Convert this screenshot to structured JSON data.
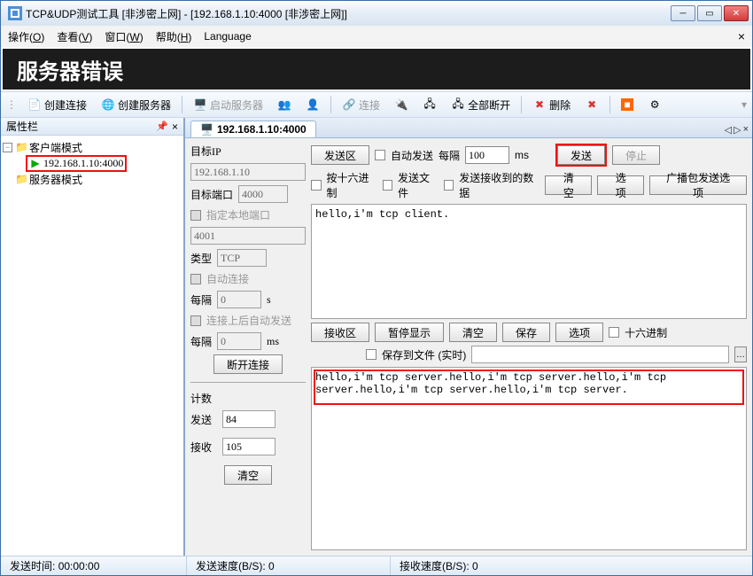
{
  "window": {
    "title": "TCP&UDP测试工具 [非涉密上网] - [192.168.1.10:4000 [非涉密上网]]"
  },
  "menu": {
    "operate": "操作(O)",
    "view": "查看(V)",
    "window": "窗口(W)",
    "help": "帮助(H)",
    "language": "Language"
  },
  "banner": "服务器错误",
  "toolbar": {
    "create_conn": "创建连接",
    "create_server": "创建服务器",
    "start_server": "启动服务器",
    "connect": "连接",
    "disconnect_all": "全部断开",
    "delete": "删除"
  },
  "sidebar": {
    "title": "属性栏",
    "nodes": {
      "client_mode": "客户端模式",
      "conn_addr": "192.168.1.10:4000",
      "server_mode": "服务器模式"
    }
  },
  "tab": {
    "label": "192.168.1.10:4000"
  },
  "form": {
    "target_ip_label": "目标IP",
    "target_ip": "192.168.1.10",
    "target_port_label": "目标端口",
    "target_port": "4000",
    "bind_local_port": "指定本地端口",
    "local_port": "4001",
    "type_label": "类型",
    "type_value": "TCP",
    "auto_connect": "自动连接",
    "interval_label": "每隔",
    "interval_unit_s": "s",
    "interval_unit_ms": "ms",
    "auto_send_after_conn": "连接上后自动发送",
    "disconnect_btn": "断开连接",
    "count_section": "计数",
    "send_count_label": "发送",
    "send_count": "84",
    "recv_count_label": "接收",
    "recv_count": "105",
    "clear_btn": "清空",
    "zero1": "0",
    "zero2": "0"
  },
  "send": {
    "area_label": "发送区",
    "auto_send": "自动发送",
    "interval_label": "每隔",
    "interval_value": "100",
    "interval_unit": "ms",
    "send_btn": "发送",
    "stop_btn": "停止",
    "hex": "按十六进制",
    "send_file": "发送文件",
    "send_recv_data": "发送接收到的数据",
    "clear": "清空",
    "options": "选项",
    "broadcast": "广播包发送选项",
    "text": "hello,i'm tcp client."
  },
  "recv": {
    "area_label": "接收区",
    "pause": "暂停显示",
    "clear": "清空",
    "save": "保存",
    "options": "选项",
    "hex": "十六进制",
    "save_to_file": "保存到文件 (实时)",
    "text": "hello,i'm tcp server.hello,i'm tcp server.hello,i'm tcp server.hello,i'm tcp server.hello,i'm tcp server."
  },
  "status": {
    "send_time_label": "发送时间:",
    "send_time": "00:00:00",
    "send_speed_label": "发送速度(B/S):",
    "send_speed": "0",
    "recv_speed_label": "接收速度(B/S):",
    "recv_speed": "0"
  }
}
